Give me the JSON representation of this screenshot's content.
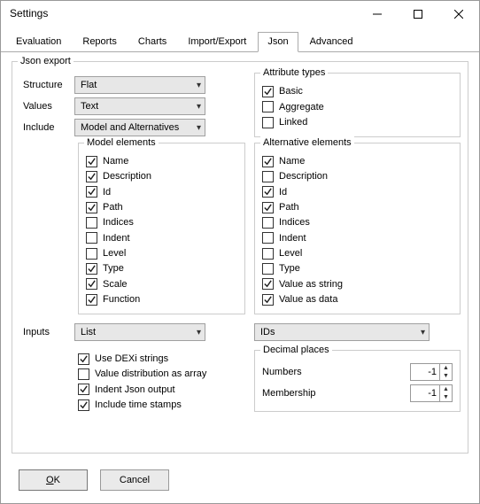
{
  "window": {
    "title": "Settings"
  },
  "tabs": {
    "items": [
      {
        "label": "Evaluation"
      },
      {
        "label": "Reports"
      },
      {
        "label": "Charts"
      },
      {
        "label": "Import/Export"
      },
      {
        "label": "Json"
      },
      {
        "label": "Advanced"
      }
    ],
    "activeIndex": 4
  },
  "jsonExport": {
    "legend": "Json export",
    "labels": {
      "structure": "Structure",
      "values": "Values",
      "include": "Include",
      "inputs": "Inputs"
    },
    "structure": "Flat",
    "values": "Text",
    "include": "Model and Alternatives",
    "inputs": "List",
    "inputsRight": "IDs"
  },
  "attributeTypes": {
    "legend": "Attribute types",
    "items": [
      {
        "label": "Basic",
        "checked": true
      },
      {
        "label": "Aggregate",
        "checked": false
      },
      {
        "label": "Linked",
        "checked": false
      }
    ]
  },
  "modelElements": {
    "legend": "Model elements",
    "items": [
      {
        "label": "Name",
        "checked": true
      },
      {
        "label": "Description",
        "checked": true
      },
      {
        "label": "Id",
        "checked": true
      },
      {
        "label": "Path",
        "checked": true
      },
      {
        "label": "Indices",
        "checked": false
      },
      {
        "label": "Indent",
        "checked": false
      },
      {
        "label": "Level",
        "checked": false
      },
      {
        "label": "Type",
        "checked": true
      },
      {
        "label": "Scale",
        "checked": true
      },
      {
        "label": "Function",
        "checked": true
      }
    ]
  },
  "altElements": {
    "legend": "Alternative elements",
    "items": [
      {
        "label": "Name",
        "checked": true
      },
      {
        "label": "Description",
        "checked": false
      },
      {
        "label": "Id",
        "checked": true
      },
      {
        "label": "Path",
        "checked": true
      },
      {
        "label": "Indices",
        "checked": false
      },
      {
        "label": "Indent",
        "checked": false
      },
      {
        "label": "Level",
        "checked": false
      },
      {
        "label": "Type",
        "checked": false
      },
      {
        "label": "Value as string",
        "checked": true
      },
      {
        "label": "Value as data",
        "checked": true
      }
    ]
  },
  "options": {
    "items": [
      {
        "label": "Use DEXi strings",
        "checked": true
      },
      {
        "label": "Value distribution as array",
        "checked": false
      },
      {
        "label": "Indent Json output",
        "checked": true
      },
      {
        "label": "Include time stamps",
        "checked": true
      }
    ]
  },
  "decimals": {
    "legend": "Decimal places",
    "numbers": {
      "label": "Numbers",
      "value": "-1"
    },
    "membership": {
      "label": "Membership",
      "value": "-1"
    }
  },
  "buttons": {
    "ok": "OK",
    "cancel": "Cancel"
  }
}
